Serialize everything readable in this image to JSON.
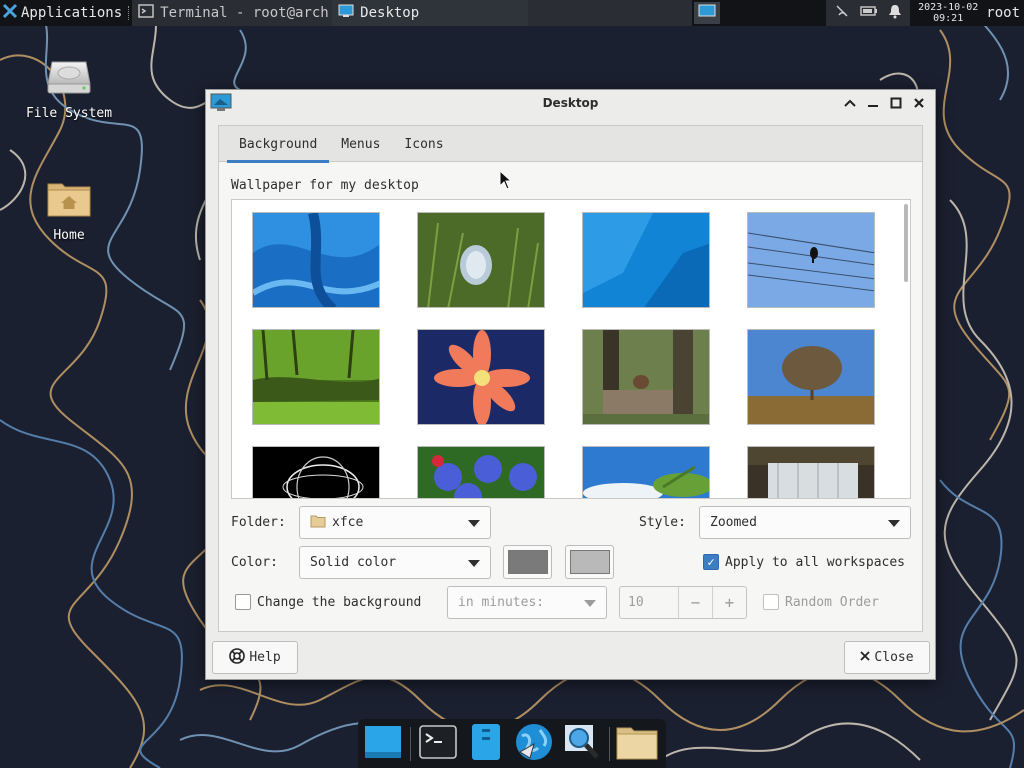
{
  "panel": {
    "applications_label": "Applications",
    "tasks": [
      {
        "label": "Terminal - root@arch..."
      },
      {
        "label": "Desktop"
      }
    ],
    "clock_date": "2023-10-02",
    "clock_time": "09:21",
    "user": "root"
  },
  "desktop_icons": [
    {
      "label": "File System"
    },
    {
      "label": "Home"
    }
  ],
  "dialog": {
    "title": "Desktop",
    "tabs": [
      {
        "label": "Background",
        "active": true
      },
      {
        "label": "Menus",
        "active": false
      },
      {
        "label": "Icons",
        "active": false
      }
    ],
    "wallpaper_label": "Wallpaper for my desktop",
    "folder_label": "Folder:",
    "folder_value": "xfce",
    "style_label": "Style:",
    "style_value": "Zoomed",
    "color_label": "Color:",
    "color_value": "Solid color",
    "color1": "#7a7a7a",
    "color2": "#b9b9b9",
    "apply_all_label": "Apply to all workspaces",
    "apply_all_checked": true,
    "change_bg_label": "Change the background",
    "change_bg_checked": false,
    "interval_value": "in minutes:",
    "interval_number": "10",
    "random_label": "Random Order",
    "help_label": "Help",
    "close_label": "Close"
  },
  "colors": {
    "accent": "#3b7ec4",
    "panel": "#111317"
  },
  "icons": [
    "xfce-logo-icon",
    "terminal-icon",
    "desktop-icon",
    "network-off-icon",
    "battery-icon",
    "bell-icon",
    "drive-icon",
    "home-folder-icon",
    "help-icon",
    "close-icon"
  ]
}
